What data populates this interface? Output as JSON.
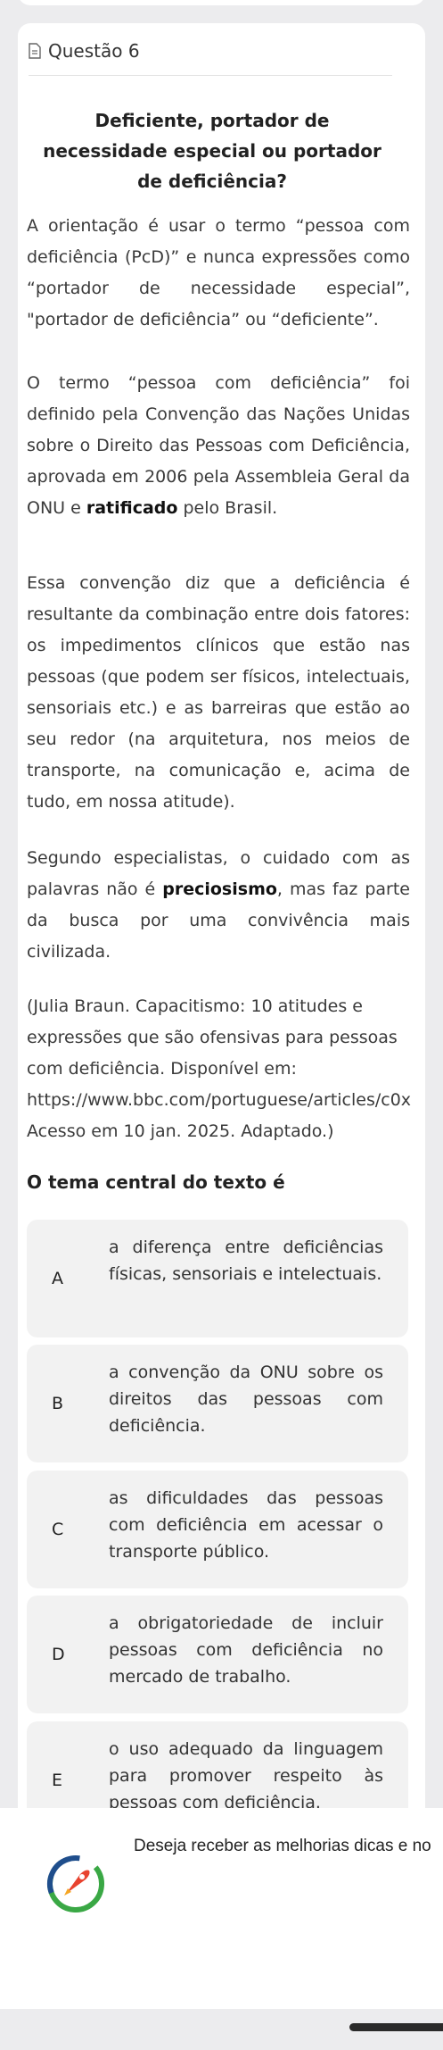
{
  "question": {
    "header_label": "Questão 6",
    "title": "Deficiente, portador de necessidade especial ou portador de deficiência?",
    "paragraphs": [
      "A orientação é usar o termo “pessoa com deficiência (PcD)” e nunca expressões como “portador de necessidade especial”, \"portador de deficiência” ou “deficiente”.",
      "Essa convenção diz que a deficiência é resultante da combinação entre dois fatores: os impedimentos clínicos que estão nas pessoas (que podem ser físicos, intelectuais, sensoriais etc.) e as barreiras que estão ao seu redor (na arquitetura, nos meios de transporte, na comunicação e, acima de tudo, em nossa atitude)."
    ],
    "para2_before": "O termo “pessoa com deficiência” foi definido pela Convenção das Nações Unidas sobre o Direito das Pessoas com Deficiência, aprovada em 2006 pela Assembleia Geral da ONU e ",
    "para2_bold": "ratificado",
    "para2_after": " pelo Brasil.",
    "para4_before": "Segundo especialistas, o cuidado com as palavras não é ",
    "para4_bold": "preciosismo",
    "para4_after": ", mas faz parte da busca por uma convivência mais civilizada.",
    "source_lines": [
      "(Julia Braun. Capacitismo: 10 atitudes e",
      "expressões que são ofensivas para pessoas",
      "com deficiência. Disponível em:",
      "https://www.bbc.com/portuguese/articles/c0x",
      "Acesso em 10 jan. 2025. Adaptado.)"
    ],
    "prompt": "O tema central do texto é",
    "options": [
      {
        "letter": "A",
        "text": "a diferença entre deficiências físicas, sensoriais e intelectuais."
      },
      {
        "letter": "B",
        "text": "a convenção da ONU sobre os direitos das pessoas com deficiência."
      },
      {
        "letter": "C",
        "text": "as dificuldades das pessoas com deficiência em acessar o transporte público."
      },
      {
        "letter": "D",
        "text": "a obrigatoriedade de incluir pessoas com deficiência no mercado de trabalho."
      },
      {
        "letter": "E",
        "text": "o uso adequado da linguagem para promover respeito às pessoas com deficiência."
      }
    ]
  },
  "banner": {
    "text": "Deseja receber as melhorias dicas e no"
  },
  "colors": {
    "background": "#ececee",
    "card": "#ffffff",
    "option_bg": "#f2f2f2",
    "logo_green": "#3aa845",
    "logo_blue": "#1f4e8c",
    "logo_red": "#e8432f"
  },
  "icons": {
    "header": "document-icon",
    "banner": "rocket-logo-icon"
  }
}
